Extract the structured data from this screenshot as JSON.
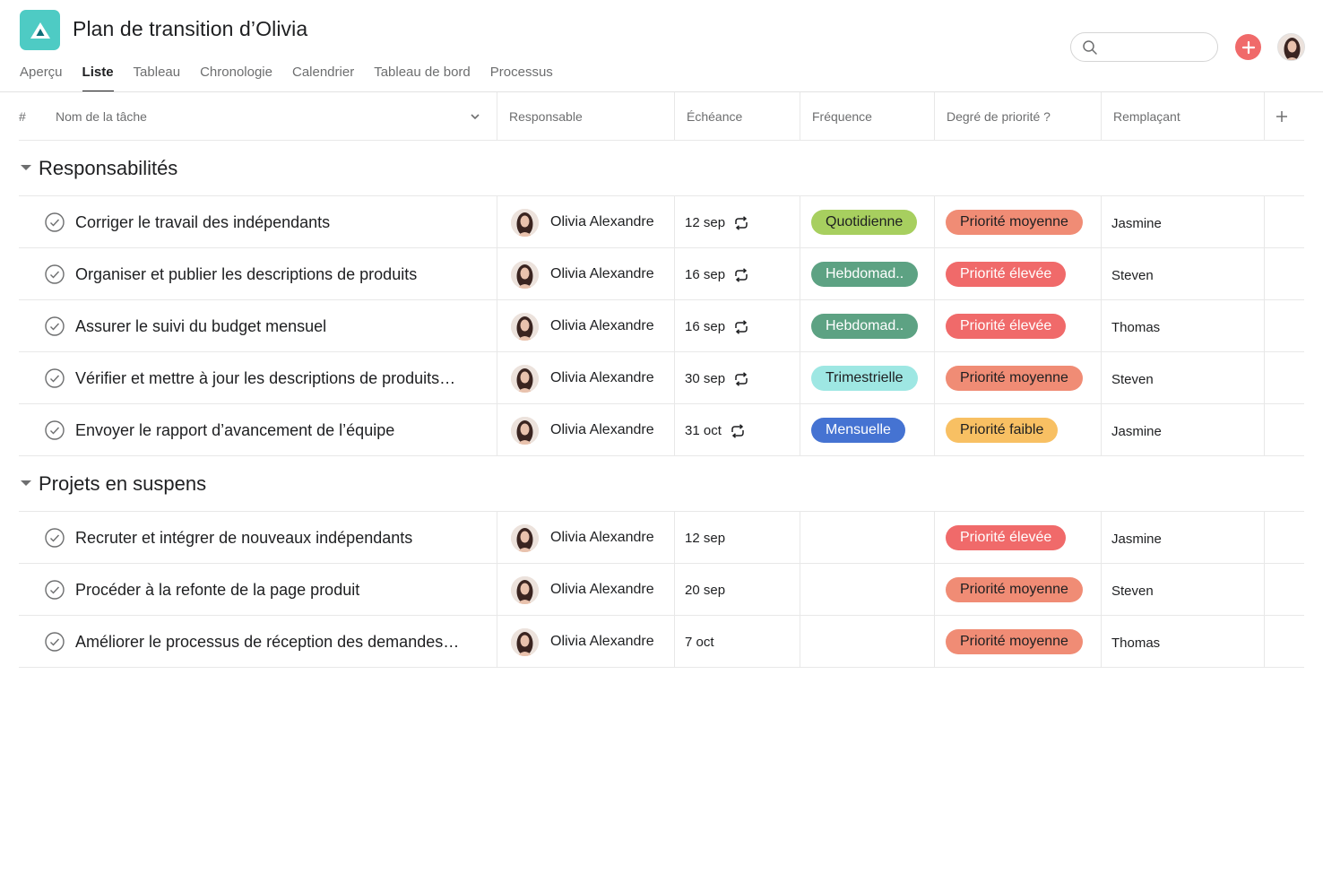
{
  "header": {
    "title": "Plan de transition d’Olivia",
    "search": {
      "placeholder": ""
    },
    "tabs": [
      {
        "label": "Aperçu",
        "active": false
      },
      {
        "label": "Liste",
        "active": true
      },
      {
        "label": "Tableau",
        "active": false
      },
      {
        "label": "Chronologie",
        "active": false
      },
      {
        "label": "Calendrier",
        "active": false
      },
      {
        "label": "Tableau de bord",
        "active": false
      },
      {
        "label": "Processus",
        "active": false
      }
    ]
  },
  "columns": {
    "number": "#",
    "task": "Nom de la tâche",
    "assignee": "Responsable",
    "due": "Échéance",
    "frequency": "Fréquence",
    "priority": "Degré de priorité ?",
    "replacement": "Remplaçant"
  },
  "sections": [
    {
      "title": "Responsabilités",
      "tasks": [
        {
          "name": "Corriger le travail des indépendants",
          "assignee": "Olivia Alexandre",
          "due": "12 sep",
          "recurring": true,
          "frequency": "Quotidienne",
          "frequency_color": "#a7cf5f",
          "frequency_text_color": "#1e1f21",
          "priority": "Priorité moyenne",
          "priority_color": "#f08c75",
          "priority_text_color": "#1e1f21",
          "replacement": "Jasmine"
        },
        {
          "name": "Organiser et publier les descriptions de produits",
          "assignee": "Olivia Alexandre",
          "due": "16 sep",
          "recurring": true,
          "frequency": "Hebdomad..",
          "frequency_color": "#5da283",
          "frequency_text_color": "#ffffff",
          "priority": "Priorité élevée",
          "priority_color": "#f06a6a",
          "priority_text_color": "#ffffff",
          "replacement": "Steven"
        },
        {
          "name": "Assurer le suivi du budget mensuel",
          "assignee": "Olivia Alexandre",
          "due": "16 sep",
          "recurring": true,
          "frequency": "Hebdomad..",
          "frequency_color": "#5da283",
          "frequency_text_color": "#ffffff",
          "priority": "Priorité élevée",
          "priority_color": "#f06a6a",
          "priority_text_color": "#ffffff",
          "replacement": "Thomas"
        },
        {
          "name": "Vérifier et mettre à jour les descriptions de produits…",
          "assignee": "Olivia Alexandre",
          "due": "30 sep",
          "recurring": true,
          "frequency": "Trimestrielle",
          "frequency_color": "#9ee7e3",
          "frequency_text_color": "#1e1f21",
          "priority": "Priorité moyenne",
          "priority_color": "#f08c75",
          "priority_text_color": "#1e1f21",
          "replacement": "Steven"
        },
        {
          "name": "Envoyer le rapport d’avancement de l’équipe",
          "assignee": "Olivia Alexandre",
          "due": "31 oct",
          "recurring": true,
          "frequency": "Mensuelle",
          "frequency_color": "#4573d2",
          "frequency_text_color": "#ffffff",
          "priority": "Priorité faible",
          "priority_color": "#f8c063",
          "priority_text_color": "#1e1f21",
          "replacement": "Jasmine"
        }
      ]
    },
    {
      "title": "Projets en suspens",
      "tasks": [
        {
          "name": "Recruter et intégrer de nouveaux indépendants",
          "assignee": "Olivia Alexandre",
          "due": "12 sep",
          "recurring": false,
          "frequency": "",
          "priority": "Priorité élevée",
          "priority_color": "#f06a6a",
          "priority_text_color": "#ffffff",
          "replacement": "Jasmine"
        },
        {
          "name": "Procéder à la refonte de la page produit",
          "assignee": "Olivia Alexandre",
          "due": "20 sep",
          "recurring": false,
          "frequency": "",
          "priority": "Priorité moyenne",
          "priority_color": "#f08c75",
          "priority_text_color": "#1e1f21",
          "replacement": "Steven"
        },
        {
          "name": "Améliorer le processus de réception des demandes…",
          "assignee": "Olivia Alexandre",
          "due": "7 oct",
          "recurring": false,
          "frequency": "",
          "priority": "Priorité moyenne",
          "priority_color": "#f08c75",
          "priority_text_color": "#1e1f21",
          "replacement": "Thomas"
        }
      ]
    }
  ]
}
